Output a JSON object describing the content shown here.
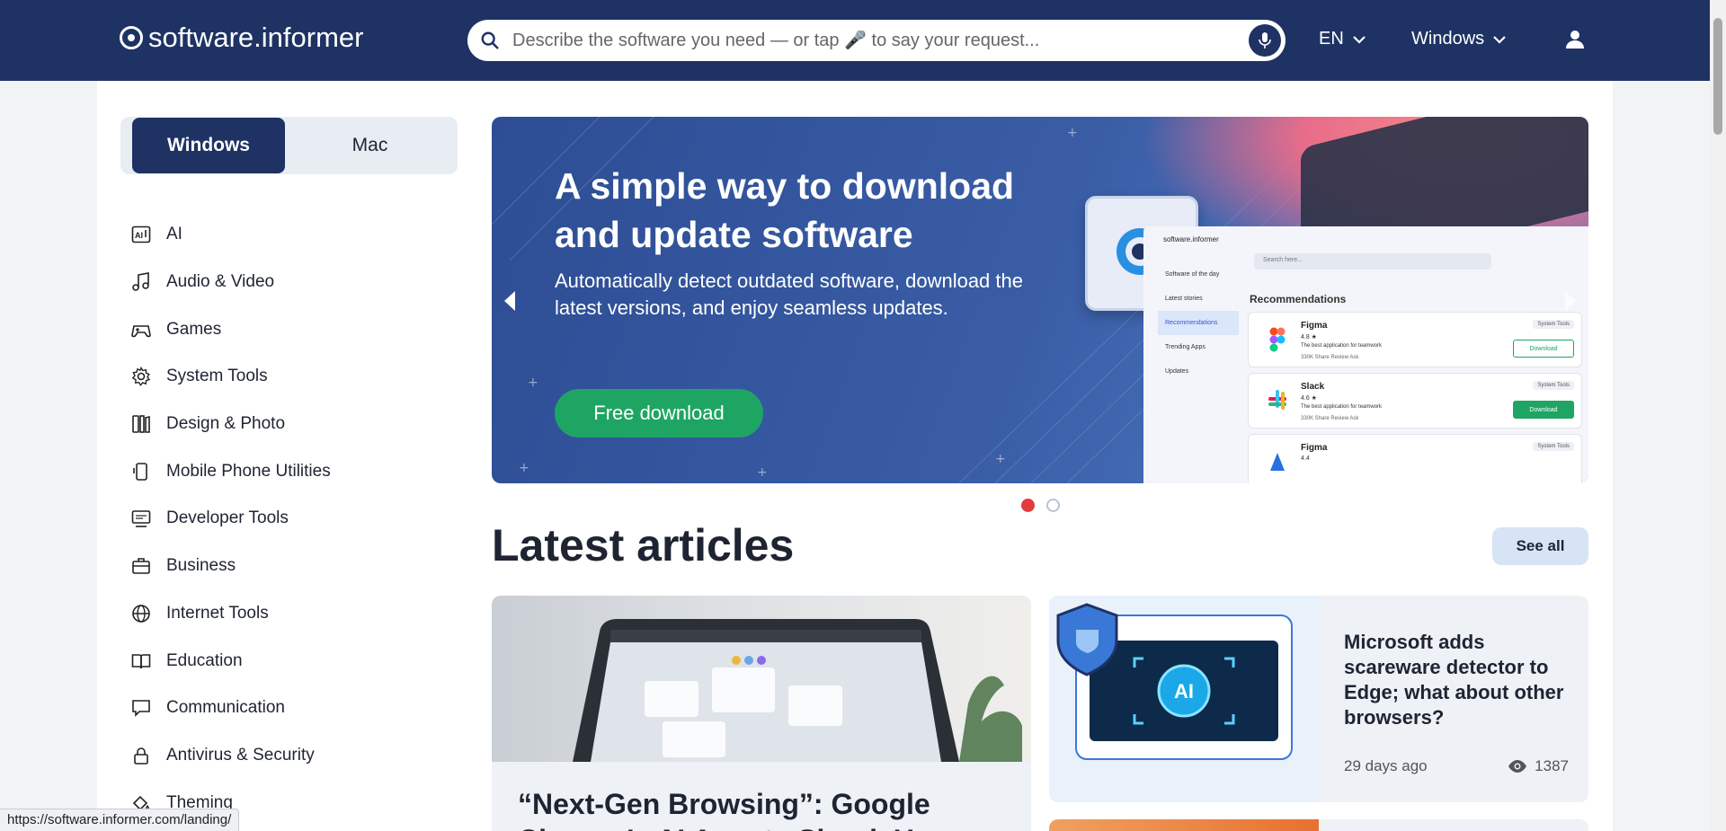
{
  "header": {
    "logo_text": "software.informer",
    "search_placeholder": "Describe the software you need — or tap 🎤 to say your request...",
    "language": "EN",
    "platform": "Windows"
  },
  "os_switch": {
    "windows_label": "Windows",
    "mac_label": "Mac",
    "selected": "Windows"
  },
  "categories": [
    {
      "label": "AI",
      "icon": "ai-icon"
    },
    {
      "label": "Audio & Video",
      "icon": "music-note-icon"
    },
    {
      "label": "Games",
      "icon": "gamepad-icon"
    },
    {
      "label": "System Tools",
      "icon": "gear-icon"
    },
    {
      "label": "Design & Photo",
      "icon": "palette-icon"
    },
    {
      "label": "Mobile Phone Utilities",
      "icon": "phone-icon"
    },
    {
      "label": "Developer Tools",
      "icon": "monitor-code-icon"
    },
    {
      "label": "Business",
      "icon": "briefcase-icon"
    },
    {
      "label": "Internet Tools",
      "icon": "globe-icon"
    },
    {
      "label": "Education",
      "icon": "book-icon"
    },
    {
      "label": "Communication",
      "icon": "chat-icon"
    },
    {
      "label": "Antivirus & Security",
      "icon": "lock-icon"
    },
    {
      "label": "Theming",
      "icon": "paint-bucket-icon"
    }
  ],
  "hero": {
    "title": "A simple way to download and update software",
    "subtitle": "Automatically detect outdated software, download the latest versions, and enjoy seamless updates.",
    "cta": "Free download",
    "active_slide": 1,
    "slide_count": 2,
    "mockup": {
      "brand": "software.informer",
      "search_placeholder": "Search here...",
      "nav": [
        "Software of the day",
        "Latest stories",
        "Recommendations",
        "Trending Apps",
        "Updates"
      ],
      "section": "Recommendations",
      "apps": [
        {
          "name": "Figma",
          "rating": "4.8 ★",
          "desc": "The best application for teamwork",
          "meta": "330K   Share   Review   Ask",
          "tag": "System Tools",
          "button": "Download"
        },
        {
          "name": "Slack",
          "rating": "4.6 ★",
          "desc": "The best application for teamwork",
          "meta": "330K   Share   Review   Ask",
          "tag": "System Tools",
          "button": "Download"
        },
        {
          "name": "Figma",
          "rating": "4.4",
          "desc": "",
          "meta": "",
          "tag": "System Tools",
          "button": ""
        }
      ]
    }
  },
  "articles": {
    "heading": "Latest articles",
    "see_all": "See all",
    "featured": {
      "title": "“Next-Gen Browsing”: Google Chrome’s AI Agents Shook Up"
    },
    "side": {
      "title": "Microsoft adds scareware detector to Edge; what about other browsers?",
      "date": "29 days ago",
      "views": "1387",
      "image_badge": "AI"
    }
  },
  "status_url": "https://software.informer.com/landing/",
  "colors": {
    "header_bg": "#1e3264",
    "accent_green": "#1fa563",
    "dot_active": "#e23c3c"
  }
}
